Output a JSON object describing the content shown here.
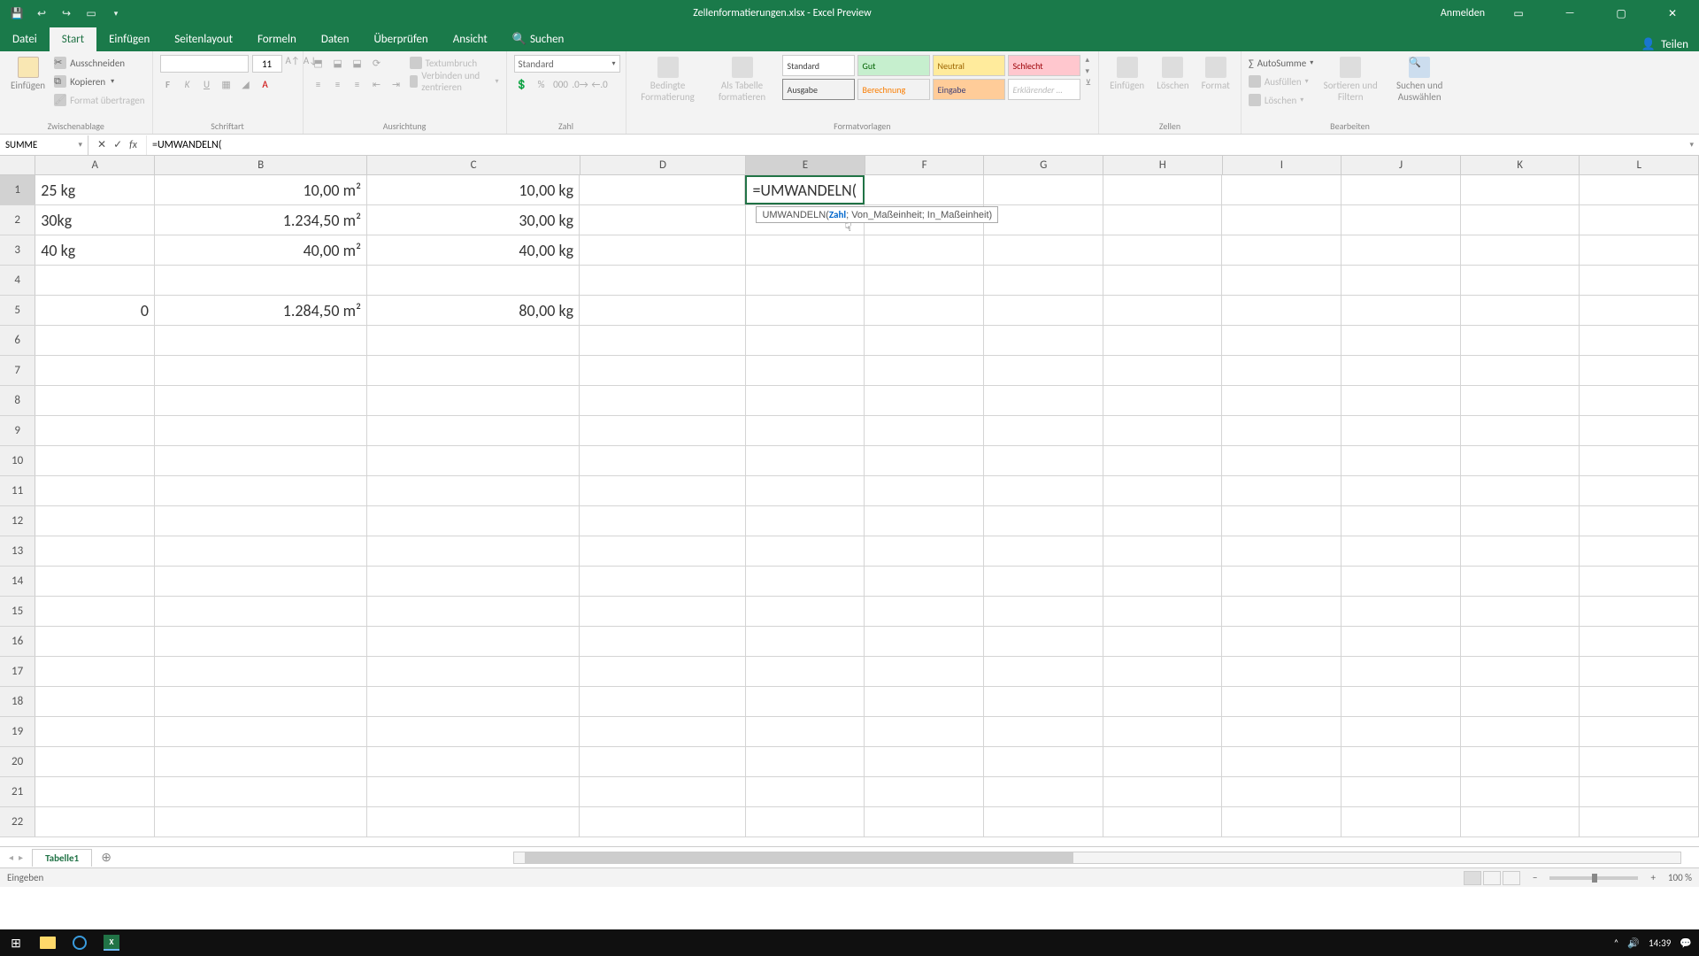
{
  "title": "Zellenformatierungen.xlsx - Excel Preview",
  "titlebar_actions": {
    "login": "Anmelden"
  },
  "tabs": {
    "file": "Datei",
    "items": [
      "Start",
      "Einfügen",
      "Seitenlayout",
      "Formeln",
      "Daten",
      "Überprüfen",
      "Ansicht"
    ],
    "active": "Start",
    "search_icon": "🔍",
    "search": "Suchen",
    "share": "Teilen"
  },
  "ribbon": {
    "clipboard": {
      "paste": "Einfügen",
      "cut": "Ausschneiden",
      "copy": "Kopieren",
      "format_painter": "Format übertragen",
      "label": "Zwischenablage"
    },
    "font": {
      "name": "",
      "size": "11",
      "bold": "F",
      "italic": "K",
      "underline": "U",
      "label": "Schriftart"
    },
    "alignment": {
      "wrap": "Textumbruch",
      "merge": "Verbinden und zentrieren",
      "label": "Ausrichtung"
    },
    "number": {
      "format": "Standard",
      "label": "Zahl"
    },
    "styles": {
      "conditional": "Bedingte Formatierung",
      "as_table": "Als Tabelle formatieren",
      "cells": [
        "Standard",
        "Gut",
        "Neutral",
        "Schlecht",
        "Ausgabe",
        "Berechnung",
        "Eingabe",
        "Erklärender …"
      ],
      "label": "Formatvorlagen"
    },
    "cells_grp": {
      "insert": "Einfügen",
      "delete": "Löschen",
      "format": "Format",
      "label": "Zellen"
    },
    "editing": {
      "autosum": "AutoSumme",
      "fill": "Ausfüllen",
      "clear": "Löschen",
      "sort": "Sortieren und Filtern",
      "find": "Suchen und Auswählen",
      "label": "Bearbeiten"
    }
  },
  "formulabar": {
    "namebox": "SUMME",
    "cancel": "✕",
    "enter": "✓",
    "fx": "fx",
    "formula": "=UMWANDELN("
  },
  "columns": [
    "A",
    "B",
    "C",
    "D",
    "E",
    "F",
    "G",
    "H",
    "I",
    "J",
    "K",
    "L"
  ],
  "rows": [
    "1",
    "2",
    "3",
    "4",
    "5",
    "6",
    "7",
    "8",
    "9",
    "10",
    "11",
    "12",
    "13",
    "14",
    "15",
    "16",
    "17",
    "18",
    "19",
    "20",
    "21",
    "22"
  ],
  "cells": {
    "A1": "25 kg",
    "B1": "10,00 m²",
    "C1": "10,00 kg",
    "A2": "30kg",
    "B2": "1.234,50 m²",
    "C2": "30,00 kg",
    "A3": "40 kg",
    "B3": "40,00 m²",
    "C3": "40,00 kg",
    "A5": "0",
    "B5": "1.284,50 m²",
    "C5": "80,00 kg",
    "E1": "=UMWANDELN("
  },
  "tooltip": {
    "func": "UMWANDELN(",
    "arg1": "Zahl",
    "rest": "; Von_Maßeinheit; In_Maßeinheit)"
  },
  "sheet": {
    "name": "Tabelle1",
    "add": "⊕"
  },
  "statusbar": {
    "mode": "Eingeben",
    "zoom": "100 %",
    "time": "14:39"
  }
}
